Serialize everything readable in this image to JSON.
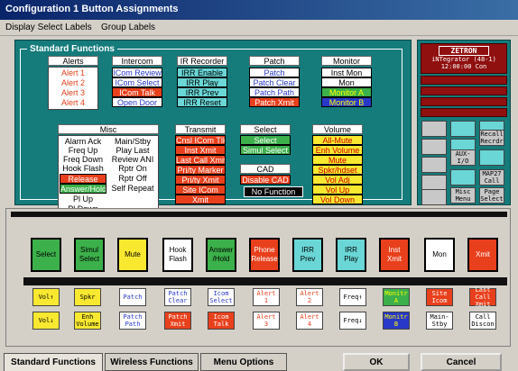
{
  "title": "Configuration 1 Button Assignments",
  "menu": [
    "Display Select Labels",
    "Group Labels"
  ],
  "sf_title": "Standard Functions",
  "alerts": {
    "title": "Alerts",
    "items": [
      "Alert 1",
      "Alert 2",
      "Alert 3",
      "Alert 4"
    ]
  },
  "intercom": {
    "title": "Intercom",
    "items": [
      "ICom Review",
      "ICom Select",
      "ICom Talk",
      "Open Door"
    ]
  },
  "irr": {
    "title": "IR Recorder",
    "items": [
      "IRR Enable",
      "IRR Play",
      "IRR Prev",
      "IRR Reset"
    ]
  },
  "patch": {
    "title": "Patch",
    "items": [
      "Patch",
      "Patch Clear",
      "Patch Path",
      "Patch Xmit"
    ]
  },
  "monitor": {
    "title": "Monitor",
    "items": [
      "Inst Mon",
      "Mon",
      "Monitor A",
      "Monitor B"
    ]
  },
  "misc": {
    "title": "Misc",
    "col1": [
      "Alarm Ack",
      "Freq Up",
      "Freq Down",
      "Hook Flash",
      "Release",
      "Answer/Hold",
      "Pl Up",
      "Pl Down"
    ],
    "col2": [
      "Main/Stby",
      "Play Last",
      "Review ANI",
      "Rptr On",
      "Rptr Off",
      "Self Repeat"
    ]
  },
  "transmit": {
    "title": "Transmit",
    "items": [
      "Cnsl ICom Tlk",
      "Inst Xmit",
      "Last Call Xmit",
      "Pri/ty Marker",
      "Pri/ty Xmit",
      "Site ICom",
      "Xmit"
    ]
  },
  "select": {
    "title": "Select",
    "items": [
      "Select",
      "Simul Select"
    ]
  },
  "cad": {
    "title": "CAD",
    "items": [
      "Disable CAD"
    ]
  },
  "volume": {
    "title": "Volume",
    "items": [
      "All-Mute",
      "Enh Volume",
      "Mute",
      "Spkr/hdset",
      "Vol Adj",
      "Vol Up",
      "Vol Down"
    ]
  },
  "nofunction": "No Function",
  "zetron": {
    "logo": "ZETRON",
    "line1": "iNTegrator (48-1)",
    "line2": "12:00:00  Con"
  },
  "rsquares": [
    "Recall Recrdr",
    "AUX- I/O",
    "MAP27 Call",
    "Misc Menu",
    "Page Select"
  ],
  "bigrow": [
    "Select",
    "Simul Select",
    "Mute",
    "Hook Flash",
    "Answer /Hold",
    "Phone Release",
    "IRR Prev",
    "IRR Play",
    "Inst Xmit",
    "Mon",
    "Xmit"
  ],
  "row1": [
    "Vol↑",
    "Spkr",
    "Patch",
    "Patch Clear",
    "Icom Select",
    "Alert 1",
    "Alert 2",
    "Freq↑",
    "Monitr A",
    "Site Icom",
    "Last Call Xmit"
  ],
  "row2": [
    "Vol↓",
    "Enh Volume",
    "Patch Path",
    "Patch Xmit",
    "Icom Talk",
    "Alert 3",
    "Alert 4",
    "Freq↓",
    "Monitr B",
    "Main- Stby",
    "Call Discon"
  ],
  "tabs": [
    "Standard Functions",
    "Wireless Functions",
    "Menu Options"
  ],
  "ok": "OK",
  "cancel": "Cancel",
  "colors": {
    "teal": "#157b7b",
    "red": "#e8401c",
    "green": "#3cb04a",
    "yellow": "#f8e830",
    "cyan": "#6ad6d6",
    "blue": "#2838c8"
  }
}
